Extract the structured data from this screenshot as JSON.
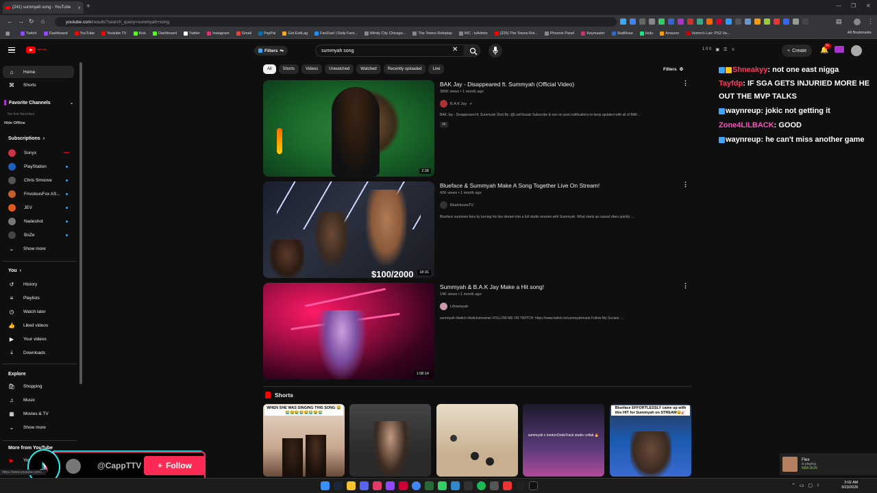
{
  "browser": {
    "tab_title": "(241) summyah song - YouTube",
    "url_host": "youtube.com",
    "url_path": "/results?search_query=summyah+song",
    "bookmarks": [
      {
        "label": "Twitch",
        "color": "#9146ff"
      },
      {
        "label": "Dashboard",
        "color": "#9146ff"
      },
      {
        "label": "YouTube",
        "color": "#ff0000"
      },
      {
        "label": "Youtube TV",
        "color": "#ff0000"
      },
      {
        "label": "Kick",
        "color": "#53fc18"
      },
      {
        "label": "Dashboard",
        "color": "#53fc18"
      },
      {
        "label": "Twitter",
        "color": "#ffffff"
      },
      {
        "label": "Instagram",
        "color": "#e1306c"
      },
      {
        "label": "Gmail",
        "color": "#ea4335"
      },
      {
        "label": "PayPal",
        "color": "#0070ba"
      },
      {
        "label": "Get ExitLag",
        "color": "#f5a623"
      },
      {
        "label": "FanDuel | Daily Fant...",
        "color": "#1493ff"
      },
      {
        "label": "Windy City Chicago...",
        "color": "#888888"
      },
      {
        "label": "The Towns Roleplay",
        "color": "#888888"
      },
      {
        "label": "WC - txAdmin",
        "color": "#888888"
      },
      {
        "label": "(225) The Towns Rol...",
        "color": "#ff0000"
      },
      {
        "label": "Phoenix Panel",
        "color": "#888888"
      },
      {
        "label": "Keymaster",
        "color": "#cc3366"
      },
      {
        "label": "StatMuse",
        "color": "#3366cc"
      },
      {
        "label": "Hulu",
        "color": "#1ce783"
      },
      {
        "label": "Amazon",
        "color": "#ff9900"
      },
      {
        "label": "Vemm's Lair: PS2 Va...",
        "color": "#cc0000"
      }
    ],
    "all_bookmarks": "All Bookmarks",
    "status_url": "https://www.youtube.com/..."
  },
  "youtube": {
    "filters_chip": "Filters",
    "search_value": "summyah song",
    "create_label": "Create",
    "notif_count": "9+",
    "top_counts": "1  0  0",
    "chips": [
      "All",
      "Shorts",
      "Videos",
      "Unwatched",
      "Watched",
      "Recently uploaded",
      "Live"
    ],
    "filters_right": "Filters"
  },
  "sidebar": {
    "home": "Home",
    "shorts": "Shorts",
    "favorite_channels": "Favorite Channels",
    "no_live": "No live favorites",
    "hide_offline": "Hide Offline",
    "subscriptions": "Subscriptions",
    "channels": [
      {
        "name": "Sonyx",
        "color": "#cc3344"
      },
      {
        "name": "PlayStation",
        "color": "#1f5fbf"
      },
      {
        "name": "Chris Smoove",
        "color": "#555555"
      },
      {
        "name": "FrivolousFox AS...",
        "color": "#c0602a"
      },
      {
        "name": "JEV",
        "color": "#e05a20"
      },
      {
        "name": "Nadeshot",
        "color": "#777777"
      },
      {
        "name": "BoZe",
        "color": "#444444"
      }
    ],
    "show_more": "Show more",
    "you": "You",
    "you_items": [
      "History",
      "Playlists",
      "Watch later",
      "Liked videos",
      "Your videos",
      "Downloads"
    ],
    "explore": "Explore",
    "explore_items": [
      "Shopping",
      "Music",
      "Movies & TV"
    ],
    "show_more_2": "Show more",
    "more_from": "More from YouTube",
    "yt_item": "YouTube"
  },
  "videos": [
    {
      "title": "BAK Jay - Disappeared ft. Summyah (Official Video)",
      "meta": "395K views • 1 month ago",
      "channel": "B.A.K Jay",
      "desc": "BAK Jay - Disappeared ft. Summyah Shot By: @LostVisualz Subscribe & turn on post notifications to keep updated with all of BAK ...",
      "badge": "4K",
      "duration": "2:28"
    },
    {
      "title": "Blueface & Summyah Make A Song Together Live On Stream!",
      "meta": "42K views • 1 month ago",
      "channel": "BlueHouseTV",
      "desc": "Blueface surprises fans by turning his live stream into a full studio session with Summyah. What starts as casual vibes quickly ...",
      "duration": "18:31",
      "overlay_text": "$100/2000"
    },
    {
      "title": "Summyah & B.A.K Jay Make a Hit song!",
      "meta": "14K views • 1 month ago",
      "channel": "Lifewmyah",
      "desc": "summyah #twitch #twitchstreamer FOLLOW ME ON TWITCH: https://www.twitch.tv/summyahmarie Follow My Socials: ...",
      "duration": "1:08:14"
    }
  ],
  "shorts": {
    "heading": "Shorts",
    "items": [
      {
        "caption": "WHEN SHE WAS SINGING THIS SONG 😭😭😭😭😭😭😭😭😭"
      },
      {
        "caption": ""
      },
      {
        "caption": ""
      },
      {
        "caption": "summyah x londonOnda­Track studio collab 🔥"
      },
      {
        "caption": "Blueface EFFORTLESSLY came up with this HIT for Summyah on STREAM😅🎸"
      }
    ]
  },
  "chat": [
    {
      "user": "Shneakyy",
      "color": "#ff3b5c",
      "msg": ": not one east nigga"
    },
    {
      "user": "Tayfdp",
      "color": "#ff3b5c",
      "msg": ": IF SGA GETS INJURIED MORE HE OUT THE MVP TALKS"
    },
    {
      "user": "waynreup",
      "color": "#ffffff",
      "msg": ": jokic not getting it"
    },
    {
      "user": "Zone4LILBACK",
      "color": "#ff4fc0",
      "msg": ": GOOD"
    },
    {
      "user": "waynreup",
      "color": "#ffffff",
      "msg": ": he can't miss another game"
    }
  ],
  "tiktok": {
    "handle": "@CappTTV",
    "follow": "Follow"
  },
  "flex": {
    "name": "Flex",
    "status": "is playing",
    "game": "NBA 2K26"
  },
  "clock": {
    "time": "3:02 AM",
    "date": "3/23/2026"
  }
}
